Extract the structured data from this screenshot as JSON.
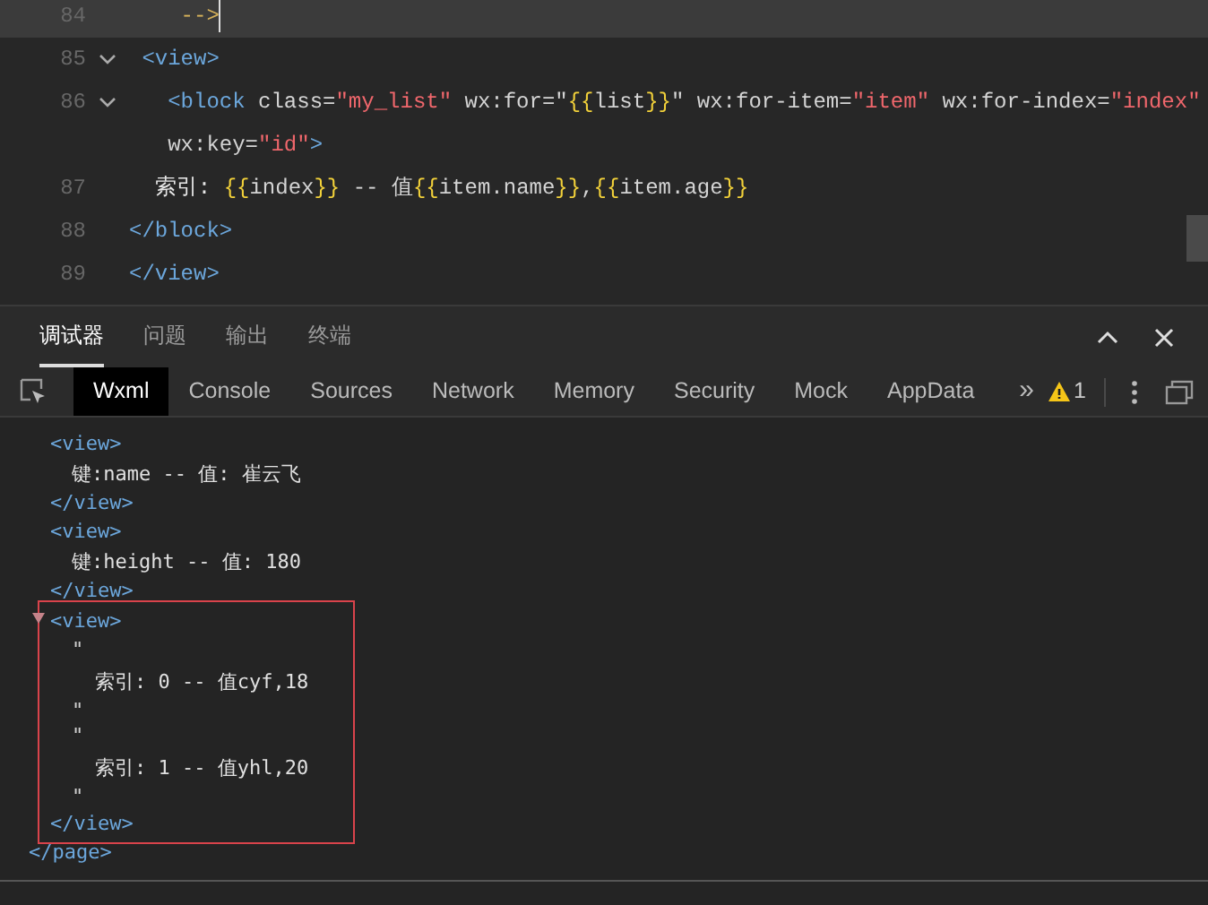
{
  "editor": {
    "lines": [
      {
        "number": "84",
        "foldable": false,
        "current": true,
        "segments": [
          {
            "kind": "comment",
            "text": "    -->"
          }
        ]
      },
      {
        "number": "85",
        "foldable": true,
        "current": false,
        "segments": [
          {
            "kind": "tag",
            "text": " <view>"
          }
        ]
      },
      {
        "number": "86",
        "foldable": true,
        "current": false,
        "segments": [
          {
            "kind": "tag",
            "text": "   <block"
          },
          {
            "kind": "attr",
            "text": " class="
          },
          {
            "kind": "string",
            "text": "\"my_list\""
          },
          {
            "kind": "attr",
            "text": " wx:for=\""
          },
          {
            "kind": "brace",
            "text": "{{"
          },
          {
            "kind": "attr",
            "text": "list"
          },
          {
            "kind": "brace",
            "text": "}}"
          },
          {
            "kind": "attr",
            "text": "\" wx:for-item="
          },
          {
            "kind": "string",
            "text": "\"item\""
          },
          {
            "kind": "attr",
            "text": " wx:for-index="
          },
          {
            "kind": "string",
            "text": "\"index\""
          }
        ]
      },
      {
        "foldable": false,
        "current": false,
        "segments": [
          {
            "kind": "attr",
            "text": "   wx:key="
          },
          {
            "kind": "string",
            "text": "\"id\""
          },
          {
            "kind": "tag",
            "text": ">"
          }
        ]
      },
      {
        "number": "87",
        "foldable": false,
        "current": false,
        "segments": [
          {
            "kind": "text",
            "text": "  索引: "
          },
          {
            "kind": "brace",
            "text": "{{"
          },
          {
            "kind": "attr",
            "text": "index"
          },
          {
            "kind": "brace",
            "text": "}}"
          },
          {
            "kind": "attr",
            "text": " -- 值"
          },
          {
            "kind": "brace",
            "text": "{{"
          },
          {
            "kind": "attr",
            "text": "item.name"
          },
          {
            "kind": "brace",
            "text": "}}"
          },
          {
            "kind": "attr",
            "text": ","
          },
          {
            "kind": "brace",
            "text": "{{"
          },
          {
            "kind": "attr",
            "text": "item.age"
          },
          {
            "kind": "brace",
            "text": "}}"
          }
        ]
      },
      {
        "number": "88",
        "foldable": false,
        "current": false,
        "segments": [
          {
            "kind": "tag",
            "text": "</block>"
          }
        ]
      },
      {
        "number": "89",
        "foldable": false,
        "current": false,
        "segments": [
          {
            "kind": "tag",
            "text": "</view>"
          }
        ]
      }
    ]
  },
  "panel_tabs": [
    {
      "label": "调试器",
      "selected": true
    },
    {
      "label": "问题",
      "selected": false
    },
    {
      "label": "输出",
      "selected": false
    },
    {
      "label": "终端",
      "selected": false
    }
  ],
  "devtools_tabs": [
    {
      "label": "Wxml",
      "selected": true
    },
    {
      "label": "Console",
      "selected": false
    },
    {
      "label": "Sources",
      "selected": false
    },
    {
      "label": "Network",
      "selected": false
    },
    {
      "label": "Memory",
      "selected": false
    },
    {
      "label": "Security",
      "selected": false
    },
    {
      "label": "Mock",
      "selected": false
    },
    {
      "label": "AppData",
      "selected": false
    }
  ],
  "more_tabs": "»",
  "warning_count": "1",
  "wxml_tree": {
    "nodes": [
      {
        "open": "<view>",
        "close": "</view>",
        "marked": false,
        "children": [
          {
            "kind": "plain",
            "text": "键:name -- 值: 崔云飞"
          }
        ]
      },
      {
        "open": "<view>",
        "close": "</view>",
        "marked": false,
        "children": [
          {
            "kind": "plain",
            "text": "键:height -- 值: 180"
          }
        ]
      },
      {
        "open": "<view>",
        "close": "</view>",
        "marked": true,
        "children": [
          {
            "kind": "quoted",
            "open": "\"",
            "text": "索引: 0 -- 值cyf,18",
            "close": "\""
          },
          {
            "kind": "quoted",
            "open": "\"",
            "text": "索引: 1 -- 值yhl,20",
            "close": "\""
          }
        ]
      }
    ],
    "page_close": "</page>"
  }
}
